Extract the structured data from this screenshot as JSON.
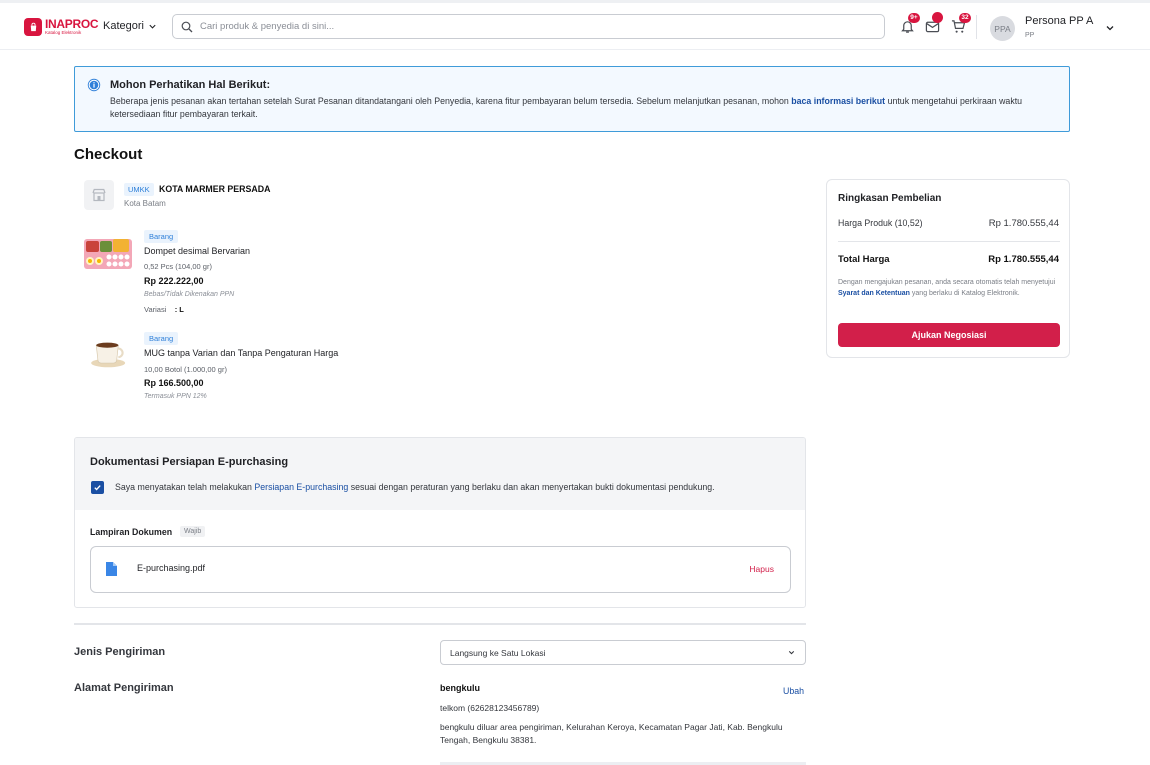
{
  "header": {
    "logo_title": "INAPROC",
    "logo_subtitle": "Katalog Elektronik",
    "kategori_label": "Kategori",
    "search_placeholder": "Cari produk & penyedia di sini...",
    "notif_badge": "9+",
    "cart_badge": "32",
    "avatar_initials": "PPA",
    "user_name": "Persona PP A",
    "user_role": "PP",
    "icons": [
      "bell-icon",
      "mail-icon",
      "cart-icon",
      "chevron-down-icon"
    ]
  },
  "notice": {
    "title": "Mohon Perhatikan Hal Berikut:",
    "body_before": "Beberapa jenis pesanan akan tertahan setelah Surat Pesanan ditandatangani oleh Penyedia, karena fitur pembayaran belum tersedia. Sebelum melanjutkan pesanan, mohon ",
    "link": "baca informasi berikut",
    "body_after": " untuk mengetahui perkiraan waktu ketersediaan fitur pembayaran terkait."
  },
  "page_title": "Checkout",
  "seller": {
    "badge": "UMKK",
    "name": "KOTA MARMER PERSADA",
    "city": "Kota Batam"
  },
  "products": [
    {
      "tag": "Barang",
      "name": "Dompet desimal Bervarian",
      "qty": "0,52 Pcs (104,00 gr)",
      "price": "Rp 222.222,00",
      "tax": "Bebas/Tidak Dikenakan PPN",
      "variant_label": "Variasi",
      "variant_value": ": L"
    },
    {
      "tag": "Barang",
      "name": "MUG tanpa Varian dan Tanpa Pengaturan Harga",
      "qty": "10,00 Botol (1.000,00 gr)",
      "price": "Rp 166.500,00",
      "tax": "Termasuk PPN 12%"
    }
  ],
  "summary": {
    "title": "Ringkasan Pembelian",
    "product_label": "Harga Produk (10,52)",
    "product_value": "Rp 1.780.555,44",
    "total_label": "Total Harga",
    "total_value": "Rp 1.780.555,44",
    "terms_before": "Dengan mengajukan pesanan, anda secara otomatis telah menyetujui ",
    "terms_link": "Syarat dan Ketentuan",
    "terms_after": " yang berlaku di Katalog Elektronik.",
    "button": "Ajukan Negosiasi"
  },
  "docs": {
    "title": "Dokumentasi Persiapan E-purchasing",
    "statement_before": "Saya menyatakan telah melakukan ",
    "statement_link": "Persiapan E-purchasing",
    "statement_after": " sesuai dengan peraturan yang berlaku dan akan menyertakan bukti dokumentasi pendukung.",
    "checked": true,
    "attach_label": "Lampiran Dokumen",
    "required_badge": "Wajib",
    "file_name": "E-purchasing.pdf",
    "delete_label": "Hapus"
  },
  "shipping": {
    "type_label": "Jenis Pengiriman",
    "type_value": "Langsung ke Satu Lokasi",
    "address_label": "Alamat Pengiriman",
    "address_name": "bengkulu",
    "address_edit": "Ubah",
    "address_phone": "telkom (62628123456789)",
    "address_text": "bengkulu diluar area pengiriman, Kelurahan Keroya, Kecamatan Pagar Jati, Kab. Bengkulu Tengah, Bengkulu 38381."
  },
  "colors": {
    "brand_red": "#d8153f",
    "link_blue": "#1a4fa3",
    "notice_border": "#3f9bd9",
    "button_red": "#d21f4a"
  }
}
